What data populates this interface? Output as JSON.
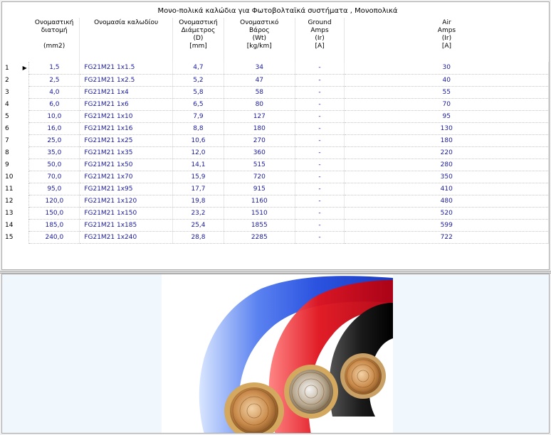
{
  "table": {
    "title": "Μονο-πολικά καλώδια για Φωτοβολταϊκά συστήματα ,  Μονοπολικά",
    "headers": {
      "cross_section": [
        "Ονομαστική",
        "διατομή",
        "",
        "(mm2)"
      ],
      "name": [
        "Ονομασία καλωδίου"
      ],
      "diameter": [
        "Ονομαστική",
        "Διάμετρος",
        "(D)",
        "[mm]"
      ],
      "weight": [
        "Ονομαστικό",
        "Βάρος",
        "(Wt)",
        "[kg/km]"
      ],
      "ground_amps": [
        "Ground",
        "Amps",
        "(Ir)",
        "[A]"
      ],
      "air_amps": [
        "Air",
        "Amps",
        "(Ir)",
        "[A]"
      ]
    },
    "current_row_marker": "▶",
    "rows": [
      {
        "n": "1",
        "section": "1,5",
        "name": "FG21M21 1x1.5",
        "diameter": "4,7",
        "weight": "34",
        "ground": "-",
        "air": "30"
      },
      {
        "n": "2",
        "section": "2,5",
        "name": "FG21M21 1x2.5",
        "diameter": "5,2",
        "weight": "47",
        "ground": "-",
        "air": "40"
      },
      {
        "n": "3",
        "section": "4,0",
        "name": "FG21M21 1x4",
        "diameter": "5,8",
        "weight": "58",
        "ground": "-",
        "air": "55"
      },
      {
        "n": "4",
        "section": "6,0",
        "name": "FG21M21 1x6",
        "diameter": "6,5",
        "weight": "80",
        "ground": "-",
        "air": "70"
      },
      {
        "n": "5",
        "section": "10,0",
        "name": "FG21M21 1x10",
        "diameter": "7,9",
        "weight": "127",
        "ground": "-",
        "air": "95"
      },
      {
        "n": "6",
        "section": "16,0",
        "name": "FG21M21 1x16",
        "diameter": "8,8",
        "weight": "180",
        "ground": "-",
        "air": "130"
      },
      {
        "n": "7",
        "section": "25,0",
        "name": "FG21M21 1x25",
        "diameter": "10,6",
        "weight": "270",
        "ground": "-",
        "air": "180"
      },
      {
        "n": "8",
        "section": "35,0",
        "name": "FG21M21 1x35",
        "diameter": "12,0",
        "weight": "360",
        "ground": "-",
        "air": "220"
      },
      {
        "n": "9",
        "section": "50,0",
        "name": "FG21M21 1x50",
        "diameter": "14,1",
        "weight": "515",
        "ground": "-",
        "air": "280"
      },
      {
        "n": "10",
        "section": "70,0",
        "name": "FG21M21 1x70",
        "diameter": "15,9",
        "weight": "720",
        "ground": "-",
        "air": "350"
      },
      {
        "n": "11",
        "section": "95,0",
        "name": "FG21M21 1x95",
        "diameter": "17,7",
        "weight": "915",
        "ground": "-",
        "air": "410"
      },
      {
        "n": "12",
        "section": "120,0",
        "name": "FG21M21 1x120",
        "diameter": "19,8",
        "weight": "1160",
        "ground": "-",
        "air": "480"
      },
      {
        "n": "13",
        "section": "150,0",
        "name": "FG21M21 1x150",
        "diameter": "23,2",
        "weight": "1510",
        "ground": "-",
        "air": "520"
      },
      {
        "n": "14",
        "section": "185,0",
        "name": "FG21M21 1x185",
        "diameter": "25,4",
        "weight": "1855",
        "ground": "-",
        "air": "599"
      },
      {
        "n": "15",
        "section": "240,0",
        "name": "FG21M21 1x240",
        "diameter": "28,8",
        "weight": "2285",
        "ground": "-",
        "air": "722"
      }
    ]
  },
  "image": {
    "cables": [
      {
        "name": "blue-cable",
        "color": "#2b53e0"
      },
      {
        "name": "red-cable",
        "color": "#e0141e"
      },
      {
        "name": "black-cable",
        "color": "#1a1a1a"
      }
    ],
    "copper_color": "#c98a4a",
    "panel_background": "#f0f7fd"
  }
}
